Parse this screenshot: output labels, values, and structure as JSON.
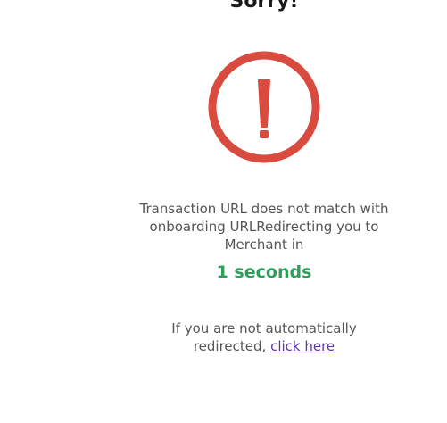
{
  "title": "Sorry!",
  "message": "Transaction URL does not match with onboarding URLRedirecting you to Merchant in",
  "countdown": "1 seconds",
  "redirect_text": "If you are not automatically redirected,",
  "redirect_link_label": "click here",
  "icon": "alert-circle-icon",
  "colors": {
    "alert": "#d94a3f",
    "countdown": "#2e9e5b",
    "link": "#5b3aa6"
  }
}
